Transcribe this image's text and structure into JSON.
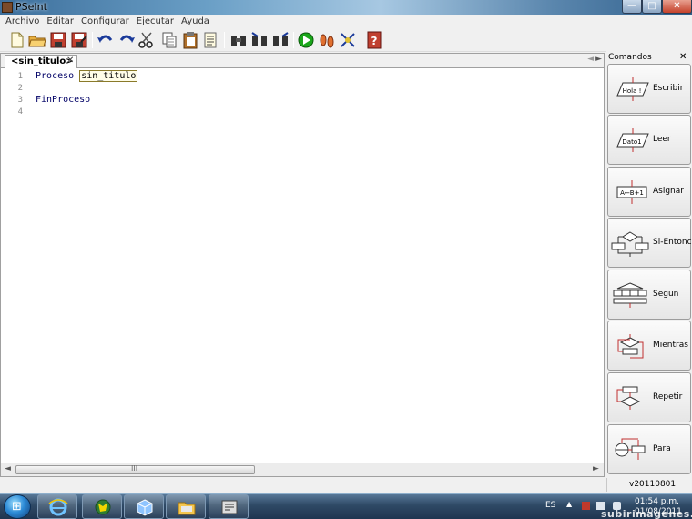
{
  "window": {
    "title": "PSeInt",
    "minimize_glyph": "—",
    "maximize_glyph": "□",
    "close_glyph": "✕"
  },
  "menu": {
    "items": [
      {
        "label": "Archivo"
      },
      {
        "label": "Editar"
      },
      {
        "label": "Configurar"
      },
      {
        "label": "Ejecutar"
      },
      {
        "label": "Ayuda"
      }
    ]
  },
  "toolbar": {
    "icons": [
      "new-file-icon",
      "open-folder-icon",
      "save-icon",
      "save-as-icon",
      "undo-icon",
      "redo-icon",
      "cut-icon",
      "copy-icon",
      "paste-icon",
      "edit-icon",
      "find-icon",
      "find-previous-icon",
      "find-next-icon",
      "run-icon",
      "step-by-step-icon",
      "debug-icon",
      "help-icon"
    ]
  },
  "editor": {
    "tab": {
      "label": "<sin_titulo>",
      "close": "✕"
    },
    "lines": [
      {
        "number": "1",
        "keyword": "Proceso",
        "identifier": "sin_titulo"
      },
      {
        "number": "2",
        "text": ""
      },
      {
        "number": "3",
        "keyword": "FinProceso"
      },
      {
        "number": "4",
        "text": ""
      }
    ],
    "scroll_left": "◄",
    "scroll_right": "►",
    "scroll_grip": "III",
    "tab_scroll_right": "►",
    "tab_scroll_left": "◄"
  },
  "commands": {
    "title": "Comandos",
    "close": "✕",
    "items": [
      {
        "label": "Escribir",
        "icon": "write-output-icon",
        "glyph": "Hola !"
      },
      {
        "label": "Leer",
        "icon": "read-input-icon",
        "glyph": "Dato1"
      },
      {
        "label": "Asignar",
        "icon": "assign-icon",
        "glyph": "A←B+1"
      },
      {
        "label": "Si-Entonces",
        "icon": "if-then-icon"
      },
      {
        "label": "Segun",
        "icon": "switch-icon"
      },
      {
        "label": "Mientras",
        "icon": "while-loop-icon"
      },
      {
        "label": "Repetir",
        "icon": "repeat-loop-icon"
      },
      {
        "label": "Para",
        "icon": "for-loop-icon"
      }
    ]
  },
  "status": {
    "version": "v20110801"
  },
  "taskbar": {
    "apps": [
      "internet-explorer-icon",
      "maps-app-icon",
      "cube-app-icon",
      "file-explorer-icon",
      "pseint-app-icon"
    ],
    "language": "ES",
    "tray_arrow": "▲",
    "time": "01:54 p.m.",
    "date": "01/08/2011",
    "watermark": "subirimagenes.net"
  },
  "colors": {
    "keyword": "#000066",
    "accent": "#2c8ad6",
    "run_green": "#1aa61a"
  }
}
